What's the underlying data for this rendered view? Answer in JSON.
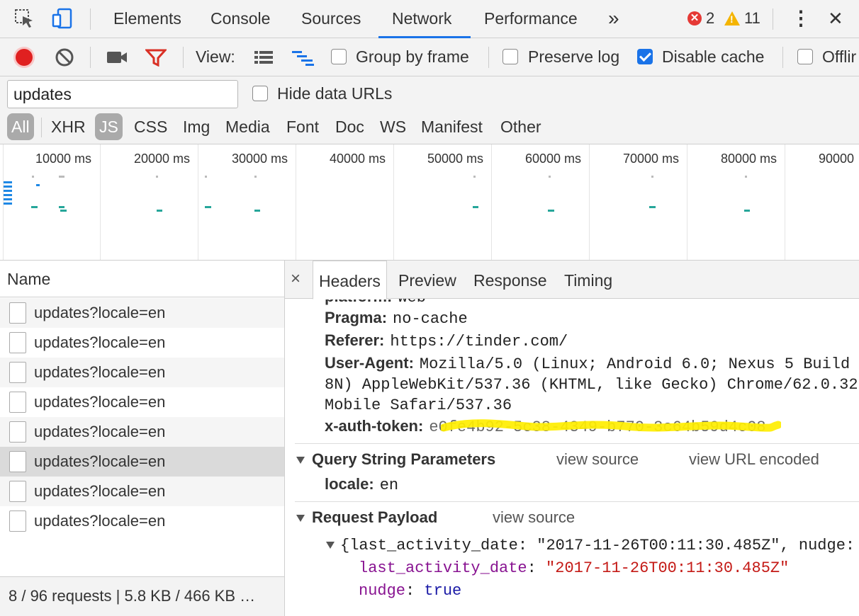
{
  "devtools": {
    "tabs": [
      "Elements",
      "Console",
      "Sources",
      "Network",
      "Performance"
    ],
    "active_tab": "Network",
    "more_tabs_glyph": "»",
    "error_count": "2",
    "warning_count": "11",
    "menu_glyph": "⋮",
    "close_glyph": "✕"
  },
  "toolbar": {
    "view_label": "View:",
    "group_by_frame": "Group by frame",
    "preserve_log": "Preserve log",
    "disable_cache": "Disable cache",
    "offline": "Offlir",
    "disable_cache_checked": true
  },
  "filter": {
    "value": "updates",
    "hide_data_urls": "Hide data URLs",
    "types": [
      "All",
      "XHR",
      "JS",
      "CSS",
      "Img",
      "Media",
      "Font",
      "Doc",
      "WS",
      "Manifest",
      "Other"
    ]
  },
  "overview": {
    "ticks": [
      "10000 ms",
      "20000 ms",
      "30000 ms",
      "40000 ms",
      "50000 ms",
      "60000 ms",
      "70000 ms",
      "80000 ms",
      "90000"
    ]
  },
  "requests": {
    "header": "Name",
    "rows": [
      "updates?locale=en",
      "updates?locale=en",
      "updates?locale=en",
      "updates?locale=en",
      "updates?locale=en",
      "updates?locale=en",
      "updates?locale=en",
      "updates?locale=en"
    ],
    "status": "8 / 96 requests | 5.8 KB / 466 KB …"
  },
  "detail": {
    "close_glyph": "×",
    "tabs": [
      "Headers",
      "Preview",
      "Response",
      "Timing"
    ],
    "active_tab": "Headers",
    "headers": {
      "platform_key": "platform:",
      "platform_val": "web",
      "pragma_key": "Pragma:",
      "pragma_val": "no-cache",
      "referer_key": "Referer:",
      "referer_val": "https://tinder.com/",
      "ua_key": "User-Agent:",
      "ua_line1": "Mozilla/5.0 (Linux; Android 6.0; Nexus 5 Build",
      "ua_line2": "8N) AppleWebKit/537.36 (KHTML, like Gecko) Chrome/62.0.32",
      "ua_line3": "Mobile Safari/537.36",
      "token_key": "x-auth-token:",
      "token_val": "e0fe4b92-5c38-4349-b770-3c64b59d4c08"
    },
    "query": {
      "title": "Query String Parameters",
      "view_source": "view source",
      "view_url_encoded": "view URL encoded",
      "param_key": "locale:",
      "param_val": "en"
    },
    "payload": {
      "title": "Request Payload",
      "view_source": "view source",
      "summary": "{last_activity_date: \"2017-11-26T00:11:30.485Z\", nudge:",
      "key1": "last_activity_date",
      "val1": "\"2017-11-26T00:11:30.485Z\"",
      "key2": "nudge",
      "val2": "true"
    }
  },
  "colors": {
    "accent": "#1a73e8",
    "record": "#e02020",
    "filter_icon": "#d93025",
    "redaction": "#ffee00"
  }
}
